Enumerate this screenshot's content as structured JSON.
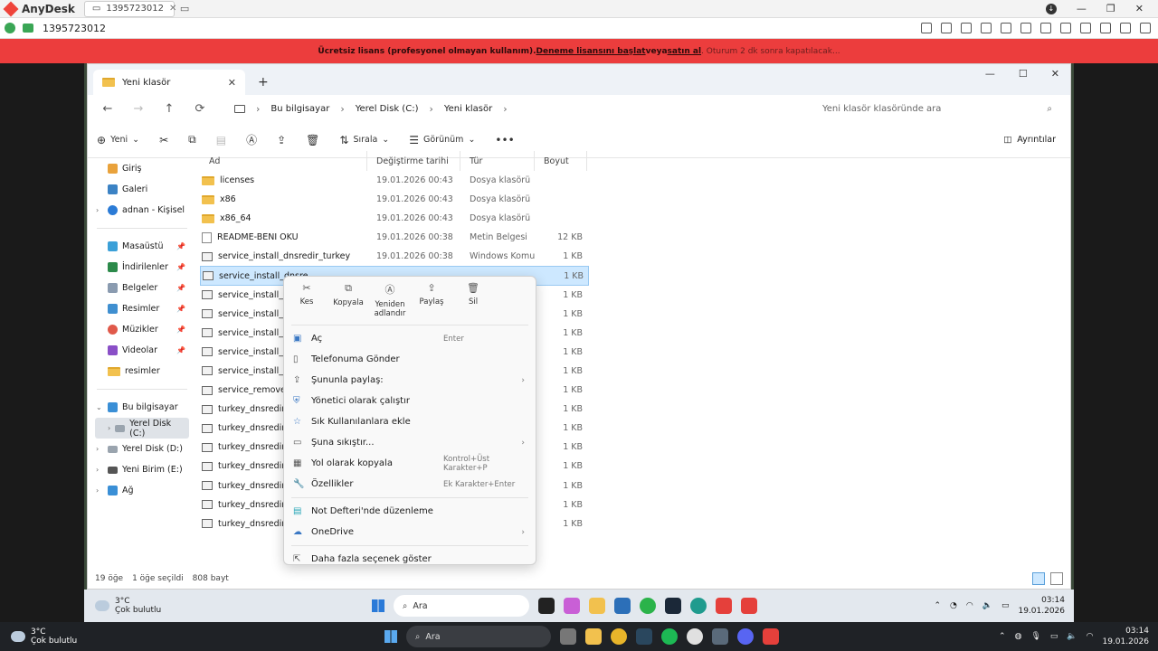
{
  "anydesk": {
    "app_name": "AnyDesk",
    "tab_id": "1395723012",
    "address_id": "1395723012",
    "banner": {
      "text1": "Ücretsiz lisans (profesyonel olmayan kullanım). ",
      "link1": "Deneme lisansını başlat",
      "text2": " veya ",
      "link2": "satın al",
      "text3": " . Oturum 2 dk sonra kapatılacak..."
    }
  },
  "explorer": {
    "tab_title": "Yeni klasör",
    "breadcrumb": [
      "Bu bilgisayar",
      "Yerel Disk (C:)",
      "Yeni klasör"
    ],
    "search_placeholder": "Yeni klasör klasöründe ara",
    "toolbar": {
      "new": "Yeni",
      "sort": "Sırala",
      "view": "Görünüm",
      "details": "Ayrıntılar"
    },
    "sidebar": [
      {
        "label": "Giriş"
      },
      {
        "label": "Galeri"
      },
      {
        "label": "adnan - Kişisel"
      },
      {
        "label": "Masaüstü"
      },
      {
        "label": "İndirilenler"
      },
      {
        "label": "Belgeler"
      },
      {
        "label": "Resimler"
      },
      {
        "label": "Müzikler"
      },
      {
        "label": "Videolar"
      },
      {
        "label": "resimler"
      },
      {
        "label": "Bu bilgisayar"
      },
      {
        "label": "Yerel Disk (C:)"
      },
      {
        "label": "Yerel Disk (D:)"
      },
      {
        "label": "Yeni Birim (E:)"
      },
      {
        "label": "Ağ"
      }
    ],
    "columns": {
      "name": "Ad",
      "date": "Değiştirme tarihi",
      "type": "Tür",
      "size": "Boyut"
    },
    "files": [
      {
        "name": "licenses",
        "date": "19.01.2026 00:43",
        "type": "Dosya klasörü",
        "size": ""
      },
      {
        "name": "x86",
        "date": "19.01.2026 00:43",
        "type": "Dosya klasörü",
        "size": ""
      },
      {
        "name": "x86_64",
        "date": "19.01.2026 00:43",
        "type": "Dosya klasörü",
        "size": ""
      },
      {
        "name": "README-BENİ OKU",
        "date": "19.01.2026 00:38",
        "type": "Metin Belgesi",
        "size": "12 KB"
      },
      {
        "name": "service_install_dnsredir_turkey",
        "date": "19.01.2026 00:38",
        "type": "Windows Komut D...",
        "size": "1 KB"
      },
      {
        "name": "service_install_dnsre",
        "date": "",
        "type": "",
        "size": "1 KB"
      },
      {
        "name": "service_install_dnsre",
        "date": "",
        "type": "",
        "size": "1 KB"
      },
      {
        "name": "service_install_dnsre",
        "date": "",
        "type": "",
        "size": "1 KB"
      },
      {
        "name": "service_install_dnsre",
        "date": "",
        "type": "",
        "size": "1 KB"
      },
      {
        "name": "service_install_dnsre",
        "date": "",
        "type": "",
        "size": "1 KB"
      },
      {
        "name": "service_install_dnsre",
        "date": "",
        "type": "",
        "size": "1 KB"
      },
      {
        "name": "service_remove",
        "date": "",
        "type": "",
        "size": "1 KB"
      },
      {
        "name": "turkey_dnsredir",
        "date": "",
        "type": "",
        "size": "1 KB"
      },
      {
        "name": "turkey_dnsredir_alte",
        "date": "",
        "type": "",
        "size": "1 KB"
      },
      {
        "name": "turkey_dnsredir_alte",
        "date": "",
        "type": "",
        "size": "1 KB"
      },
      {
        "name": "turkey_dnsredir_alte",
        "date": "",
        "type": "",
        "size": "1 KB"
      },
      {
        "name": "turkey_dnsredir_alte",
        "date": "",
        "type": "",
        "size": "1 KB"
      },
      {
        "name": "turkey_dnsredir_alte",
        "date": "",
        "type": "",
        "size": "1 KB"
      },
      {
        "name": "turkey_dnsredir_alte",
        "date": "",
        "type": "",
        "size": "1 KB"
      }
    ],
    "status": {
      "count": "19 öğe",
      "selected": "1 öğe seçildi",
      "size": "808 bayt"
    }
  },
  "context_menu": {
    "actions": [
      {
        "label": "Kes"
      },
      {
        "label": "Kopyala"
      },
      {
        "label": "Yeniden adlandır"
      },
      {
        "label": "Paylaş"
      },
      {
        "label": "Sil"
      }
    ],
    "items": [
      {
        "label": "Aç",
        "shortcut": "Enter"
      },
      {
        "label": "Telefonuma Gönder",
        "shortcut": ""
      },
      {
        "label": "Şununla paylaş:",
        "shortcut": ""
      },
      {
        "label": "Yönetici olarak çalıştır",
        "shortcut": ""
      },
      {
        "label": "Sık Kullanılanlara ekle",
        "shortcut": ""
      },
      {
        "label": "Şuna sıkıştır...",
        "shortcut": ""
      },
      {
        "label": "Yol olarak kopyala",
        "shortcut": "Kontrol+Üst Karakter+P"
      },
      {
        "label": "Özellikler",
        "shortcut": "Ek Karakter+Enter"
      },
      {
        "label": "Not Defteri'nde düzenleme",
        "shortcut": ""
      },
      {
        "label": "OneDrive",
        "shortcut": ""
      },
      {
        "label": "Daha fazla seçenek göster",
        "shortcut": ""
      }
    ]
  },
  "remote_taskbar": {
    "temp": "3°C",
    "weather": "Çok bulutlu",
    "search": "Ara",
    "time": "03:14",
    "date": "19.01.2026"
  },
  "host_taskbar": {
    "temp": "3°C",
    "weather": "Çok bulutlu",
    "search": "Ara",
    "time": "03:14",
    "date": "19.01.2026"
  }
}
